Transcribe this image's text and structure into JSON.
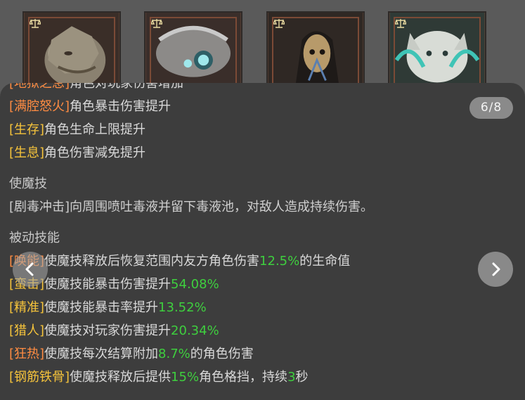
{
  "pager": {
    "current": "6/8"
  },
  "portraits": [
    {
      "name": "dragon-portrait"
    },
    {
      "name": "insect-portrait"
    },
    {
      "name": "masked-portrait"
    },
    {
      "name": "tiger-portrait"
    }
  ],
  "cut_line": {
    "tag": "[地狱之息]",
    "text": "角色对玩家伤害增加"
  },
  "buffs": [
    {
      "tag": "[满腔怒火]",
      "text": "角色暴击伤害提升",
      "tag_color": "orange"
    },
    {
      "tag": "[生存]",
      "text": "角色生命上限提升",
      "tag_color": "yellow"
    },
    {
      "tag": "[生息]",
      "text": "角色伤害减免提升",
      "tag_color": "yellow"
    }
  ],
  "active_skill": {
    "title": "使魔技",
    "desc": "[剧毒冲击]向周围喷吐毒液并留下毒液池，对敌人造成持续伤害。"
  },
  "passive_skills": {
    "title": "被动技能",
    "items": [
      {
        "tag": "[唤能]",
        "pre": "使魔技释放后恢复范围内友方角色伤害",
        "val": "12.5%",
        "post": "的生命值",
        "tag_color": "orange"
      },
      {
        "tag": "[蛮击]",
        "pre": "使魔技能暴击伤害提升",
        "val": "54.08%",
        "post": "",
        "tag_color": "yellow"
      },
      {
        "tag": "[精准]",
        "pre": "使魔技能暴击率提升",
        "val": "13.52%",
        "post": "",
        "tag_color": "yellow"
      },
      {
        "tag": "[猎人]",
        "pre": "使魔技对玩家伤害提升",
        "val": "20.34%",
        "post": "",
        "tag_color": "yellow"
      },
      {
        "tag": "[狂热]",
        "pre": "使魔技每次结算附加",
        "val": "8.7%",
        "post": "的角色伤害",
        "tag_color": "orange"
      },
      {
        "tag": "[钢筋铁骨]",
        "pre": "使魔技释放后提供",
        "val": "15%",
        "post": "角色格挡，持续",
        "val2": "3",
        "post2": "秒",
        "tag_color": "yellow"
      }
    ]
  },
  "colors": {
    "orange_tag": "#ff8c42",
    "yellow_tag": "#f5c33b",
    "value_green": "#3ecf3e",
    "panel_bg": "#3d3d3d"
  },
  "icons": {
    "left": "chevron-left-icon",
    "right": "chevron-right-icon",
    "scale": "scale-icon"
  }
}
